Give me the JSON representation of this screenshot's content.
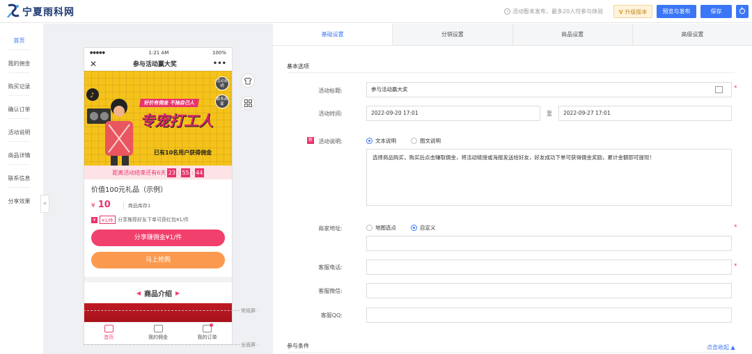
{
  "topbar": {
    "brand": "宁夏雨科网",
    "notice": "活动暂未发布，最多20人可参与体验",
    "upgrade_label": "升级版本",
    "preview_publish_label": "预览与发布",
    "save_label": "保存"
  },
  "sidebar": {
    "items": [
      {
        "label": "首页"
      },
      {
        "label": "我的佣金"
      },
      {
        "label": "购买记录"
      },
      {
        "label": "确认订单"
      },
      {
        "label": "活动说明"
      },
      {
        "label": "商品详情"
      },
      {
        "label": "联系信息"
      },
      {
        "label": "分享效果"
      }
    ],
    "collapse_glyph": "«"
  },
  "phone": {
    "status_time": "1:21 AM",
    "status_battery": "100%",
    "status_signal": "●●●●●",
    "title": "参与活动赢大奖",
    "banner": {
      "badge_rules": "活动说明",
      "badge_contact": "联系商家",
      "slogan": "好价有佣金  不抽自己人",
      "headline": "专宠打工人",
      "sub": "已有10名用户获得佣金"
    },
    "countdown": {
      "label": "距离活动结束还有6天",
      "hours": "23",
      "minutes": "55",
      "seconds": "44",
      "sep": ":"
    },
    "product": {
      "title": "价值100元礼品（示例）",
      "currency": "¥",
      "price": "10",
      "stock": "商品库存1",
      "reward_tag": "¥1/件",
      "reward_text": "分享推荐好友下单可获红包¥1/件"
    },
    "share_button": "分享赚佣金¥1/件",
    "buy_button": "马上抢购",
    "intro_title": "商品介绍",
    "tabs": [
      {
        "label": "首页"
      },
      {
        "label": "我的佣金"
      },
      {
        "label": "我的订单"
      }
    ]
  },
  "preview_markers": {
    "normal": "常规屏",
    "full": "全面屏"
  },
  "tabs": [
    {
      "label": "基础设置"
    },
    {
      "label": "分销设置"
    },
    {
      "label": "商品设置"
    },
    {
      "label": "高级设置"
    }
  ],
  "form": {
    "section_basic": "基本选项",
    "title_label": "活动标题:",
    "title_value": "参与活动赢大奖",
    "time_label": "活动时间:",
    "start_time": "2022-09-20 17:01",
    "time_sep": "至",
    "end_time": "2022-09-27 17:01",
    "new_badge": "新",
    "desc_label": "活动说明:",
    "desc_opt_text": "文本说明",
    "desc_opt_rich": "图文说明",
    "desc_value": "选择商品购买，购买后点击赚取佣金，将活动链接或海报发送给好友，好友成功下单可获得佣金奖励，累计金额即可提现！",
    "address_label": "商家地址:",
    "addr_opt_map": "地图选点",
    "addr_opt_custom": "自定义",
    "phone_label": "客服电话:",
    "wechat_label": "客服微信:",
    "qq_label": "客服QQ:",
    "section_conditions": "参与条件",
    "collapse_link": "点击收起 ▲",
    "required_mark": "*"
  },
  "colors": {
    "primary": "#3b76f6",
    "accent": "#e9336c",
    "orange": "#fb9a4f",
    "banner_yellow": "#f5c21b"
  }
}
